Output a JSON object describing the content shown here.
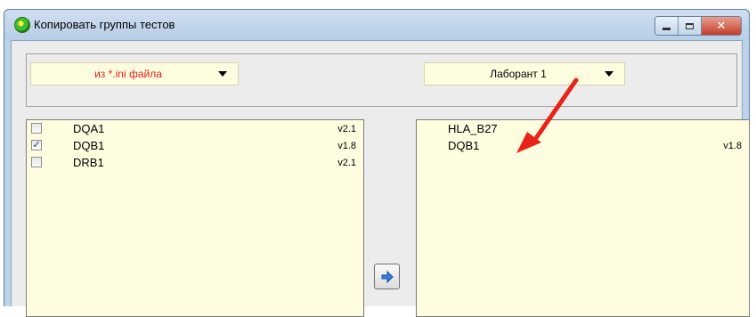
{
  "window": {
    "title": "Копировать группы тестов",
    "icon": "app-globe-icon",
    "controls": {
      "minimize": "minimize-icon",
      "maximize": "maximize-icon",
      "close": "close-icon",
      "close_glyph": "✕"
    }
  },
  "source_select": {
    "value": "из *.ini файла",
    "color": "#e81e1e"
  },
  "target_select": {
    "value": "Лаборант 1"
  },
  "source_list": {
    "items": [
      {
        "name": "DQA1",
        "version": "v2.1",
        "checked": false
      },
      {
        "name": "DQB1",
        "version": "v1.8",
        "checked": true
      },
      {
        "name": "DRB1",
        "version": "v2.1",
        "checked": false
      }
    ]
  },
  "target_list": {
    "items": [
      {
        "name": "HLA_B27",
        "version": ""
      },
      {
        "name": "DQB1",
        "version": "v1.8"
      }
    ]
  },
  "copy_button": {
    "icon": "arrow-right-icon"
  },
  "annotation": {
    "icon": "red-arrow-icon",
    "color": "#e8241a"
  },
  "colors": {
    "list_background": "#fffde0",
    "panel_background": "#ececec",
    "frame": "#bcd3ea"
  }
}
